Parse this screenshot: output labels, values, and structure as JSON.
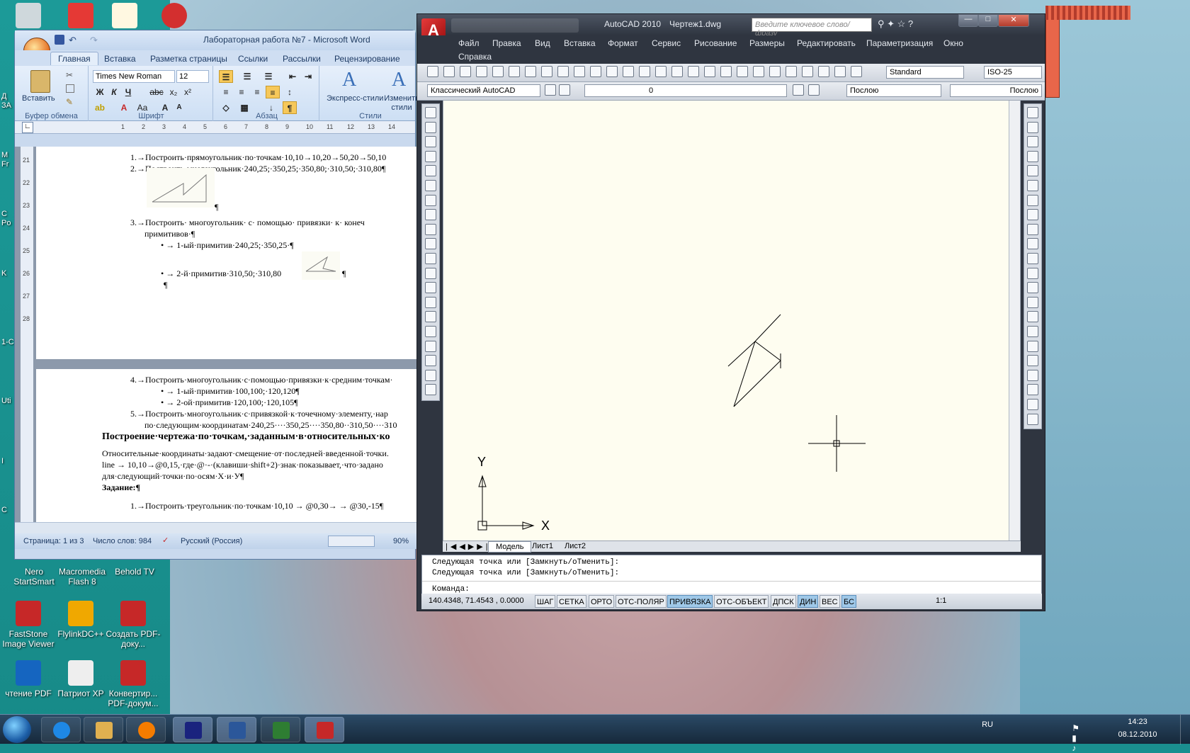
{
  "desktop": {
    "icons": [
      {
        "label": "Nero StartSmart",
        "color": "#222"
      },
      {
        "label": "Macromedia Flash 8",
        "color": "#333"
      },
      {
        "label": "Behold TV",
        "color": "#2c2c2c"
      },
      {
        "label": "FastStone Image Viewer",
        "color": "#c62828"
      },
      {
        "label": "FlylinkDC++",
        "color": "#f0a800"
      },
      {
        "label": "Создать PDF-доку...",
        "color": "#c62828"
      },
      {
        "label": "чтение PDF",
        "color": "#1565c0"
      },
      {
        "label": "Патриот XP",
        "color": "#ddd"
      },
      {
        "label": "Конвертир... PDF-докум...",
        "color": "#c62828"
      }
    ],
    "edge_labels": [
      "Д",
      "ЗА",
      "M",
      "Fr",
      "C",
      "Po",
      "K",
      "1-C",
      "Uti",
      "I",
      "C"
    ]
  },
  "word": {
    "title": "Лабораторная работа №7 - Microsoft Word",
    "tabs": [
      "Главная",
      "Вставка",
      "Разметка страницы",
      "Ссылки",
      "Рассылки",
      "Рецензирование"
    ],
    "font_name": "Times New Roman",
    "font_size": "12",
    "groups": [
      "Буфер обмена",
      "Шрифт",
      "Абзац",
      "Стили"
    ],
    "paste_label": "Вставить",
    "express_styles": "Экспресс-стили",
    "change_styles": "Изменить стили",
    "doc_lines": [
      "1.→Построить·прямоугольник·по·точкам·10,10→10,20→50,20→50,10",
      "2.→Построить·многоугольник·240,25;·350,25;·350,80;·310,50;·310,80¶",
      "¶",
      "3.→Построить·   многоугольник·   с·   помощью·   привязки·   к·   конеч",
      "примитивов·¶",
      "•  →  1-ый·примитив·240,25;·350,25·¶",
      "•  →  2-й·примитив·310,50;·310,80",
      "¶",
      "¶",
      "4.→Построить·многоугольник·с·помощью·привязки·к·средним·точкам·",
      "•  →  1-ый·примитив·100,100;·120,120¶",
      "•  →  2-ой·примитив·120,100;·120,105¶",
      "5.→Построить·многоугольник·с·привязкой·к·точечному·элементу,·нар",
      "по·следующим·координатам·240,25····350,25····350,80··310,50····310",
      "Построение·чертежа·по·точкам,·заданным·в·относительных·ко",
      "Относительные·координаты·задают·смещение·от·последней·введенной·точки.",
      "line →  10,10→@0,15,·где·@·-·(клавиши·shift+2)·знак·показывает,·что·задано",
      "для·следующий·точки·по·осям·X·и·У¶",
      "Задание:¶",
      "1.→Построить·треугольник·по·точкам·10,10   →   @0,30→   →   @30,-15¶"
    ],
    "status": {
      "page": "Страница: 1 из 3",
      "words": "Число слов: 984",
      "lang": "Русский (Россия)",
      "zoom": "90%"
    },
    "ruler_numbers": [
      "1",
      "2",
      "3",
      "4",
      "5",
      "6",
      "7",
      "8",
      "9",
      "10",
      "11",
      "12",
      "13",
      "14"
    ],
    "vruler_numbers": [
      "21",
      "22",
      "23",
      "24",
      "25",
      "26",
      "27",
      "28"
    ]
  },
  "autocad": {
    "app": "AutoCAD 2010",
    "file": "Чертеж1.dwg",
    "search_placeholder": "Введите ключевое слово/фразу",
    "menus": [
      "Файл",
      "Правка",
      "Вид",
      "Вставка",
      "Формат",
      "Сервис",
      "Рисование",
      "Размеры",
      "Редактировать",
      "Параметризация",
      "Окно"
    ],
    "menu_help": "Справка",
    "text_style": "Standard",
    "dim_style": "ISO-25",
    "workspace": "Классический AutoCAD",
    "layer": "0",
    "color": "Послою",
    "linetype": "Послою",
    "layout_tabs": [
      "Модель",
      "Лист1",
      "Лист2"
    ],
    "cmd_history": [
      "Следующая точка или [Замкнуть/оТменить]:",
      "Следующая точка или [Замкнуть/оТменить]:"
    ],
    "cmd_prompt": "Команда:",
    "coords": "140.4348, 71.4543 , 0.0000",
    "status_buttons": [
      {
        "label": "ШАГ",
        "on": false
      },
      {
        "label": "СЕТКА",
        "on": false
      },
      {
        "label": "ОРТО",
        "on": false
      },
      {
        "label": "ОТС-ПОЛЯР",
        "on": false
      },
      {
        "label": "ПРИВЯЗКА",
        "on": true
      },
      {
        "label": "ОТС-ОБЪЕКТ",
        "on": false
      },
      {
        "label": "ДПСК",
        "on": false
      },
      {
        "label": "ДИН",
        "on": true
      },
      {
        "label": "ВЕС",
        "on": false
      },
      {
        "label": "БС",
        "on": true
      }
    ],
    "scale": "1:1",
    "ucs_x": "X",
    "ucs_y": "Y"
  },
  "taskbar": {
    "lang": "RU",
    "time": "14:23",
    "date": "08.12.2010"
  }
}
